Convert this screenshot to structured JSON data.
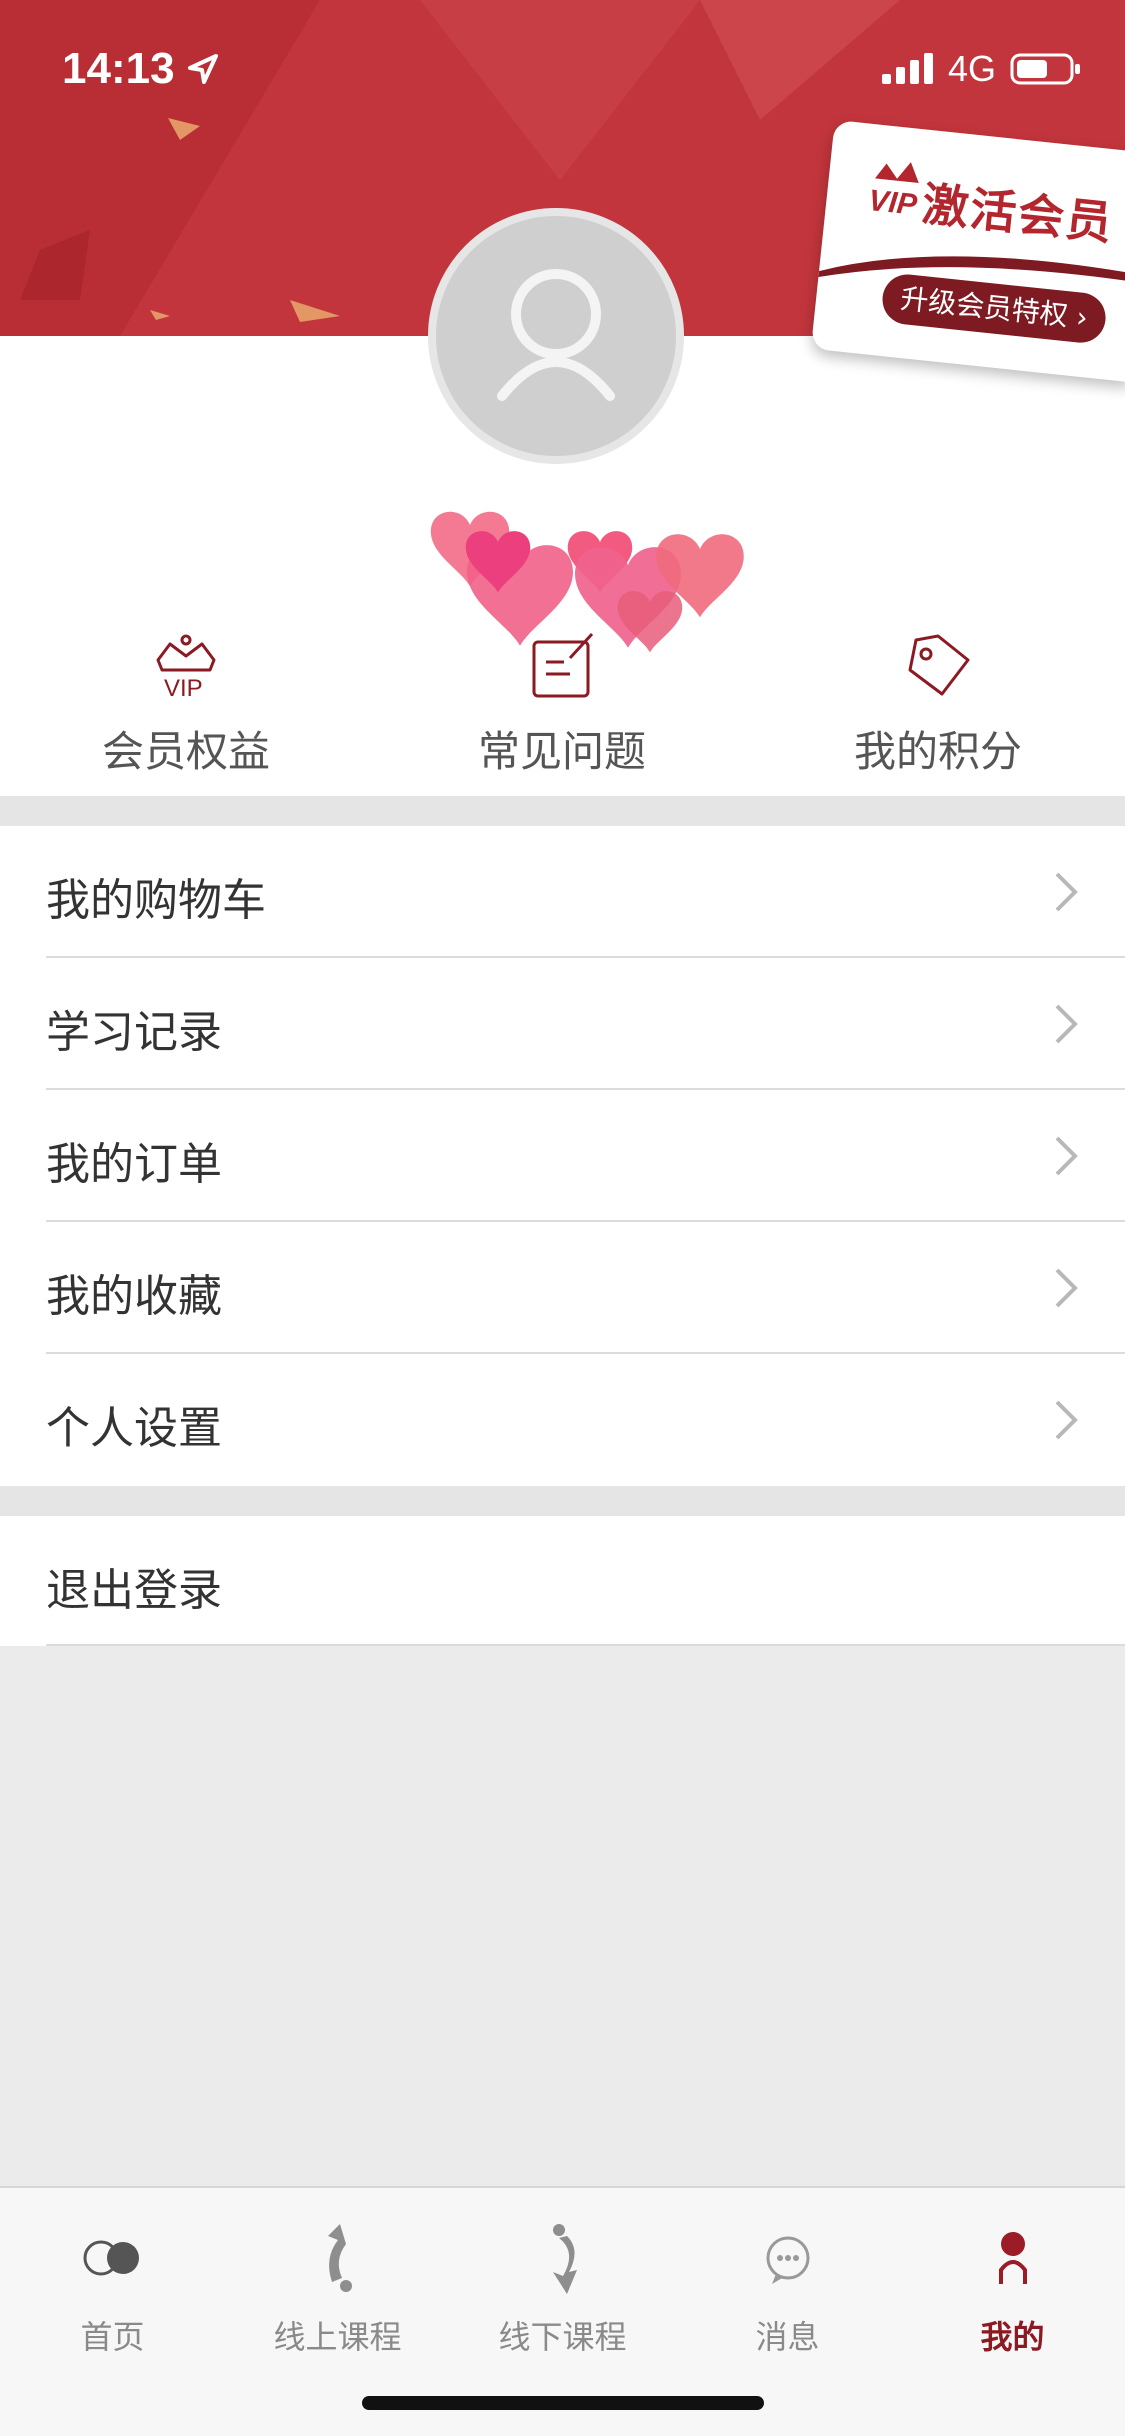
{
  "status_bar": {
    "time": "14:13",
    "network": "4G"
  },
  "vip_card": {
    "badge": "VIP",
    "title": "激活会员",
    "subtitle": "升级会员特权 ›"
  },
  "quick_links": [
    {
      "label": "会员权益",
      "icon": "vip-crown-icon",
      "badge": "VIP"
    },
    {
      "label": "常见问题",
      "icon": "edit-note-icon"
    },
    {
      "label": "我的积分",
      "icon": "tag-icon"
    }
  ],
  "menu": [
    {
      "label": "我的购物车"
    },
    {
      "label": "学习记录"
    },
    {
      "label": "我的订单"
    },
    {
      "label": "我的收藏"
    },
    {
      "label": "个人设置"
    }
  ],
  "logout": {
    "label": "退出登录"
  },
  "tabs": [
    {
      "label": "首页",
      "icon": "home-toggle-icon",
      "active": false
    },
    {
      "label": "线上课程",
      "icon": "online-course-icon",
      "active": false
    },
    {
      "label": "线下课程",
      "icon": "offline-course-icon",
      "active": false
    },
    {
      "label": "消息",
      "icon": "message-icon",
      "active": false
    },
    {
      "label": "我的",
      "icon": "profile-icon",
      "active": true
    }
  ],
  "colors": {
    "brand_red": "#c3353c",
    "dark_red": "#8b1a22",
    "inactive_gray": "#8a8a8a"
  }
}
